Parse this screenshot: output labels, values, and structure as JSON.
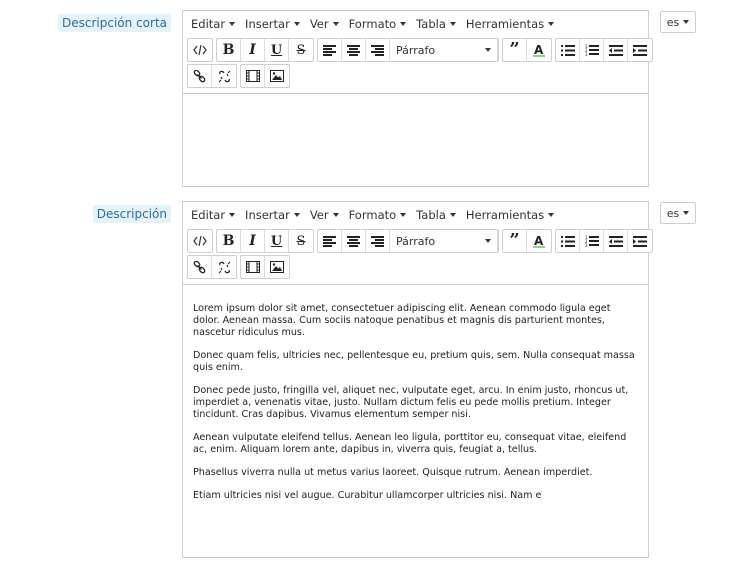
{
  "fields": [
    {
      "label": "Descripción corta",
      "menus": [
        "Editar",
        "Insertar",
        "Ver",
        "Formato",
        "Tabla",
        "Herramientas"
      ],
      "format_select": "Párrafo",
      "lang": "es",
      "paragraphs": []
    },
    {
      "label": "Descripción",
      "menus": [
        "Editar",
        "Insertar",
        "Ver",
        "Formato",
        "Tabla",
        "Herramientas"
      ],
      "format_select": "Párrafo",
      "lang": "es",
      "paragraphs": [
        "Lorem ipsum dolor sit amet, consectetuer adipiscing elit. Aenean commodo ligula eget dolor. Aenean massa. Cum sociis natoque penatibus et magnis dis parturient montes, nascetur ridiculus mus.",
        "Donec quam felis, ultricies nec, pellentesque eu, pretium quis, sem. Nulla consequat massa quis enim.",
        "Donec pede justo, fringilla vel, aliquet nec, vulputate eget, arcu. In enim justo, rhoncus ut, imperdiet a, venenatis vitae, justo. Nullam dictum felis eu pede mollis pretium. Integer tincidunt. Cras dapibus. Vivamus elementum semper nisi.",
        "Aenean vulputate eleifend tellus. Aenean leo ligula, porttitor eu, consequat vitae, eleifend ac, enim. Aliquam lorem ante, dapibus in, viverra quis, feugiat a, tellus.",
        "Phasellus viverra nulla ut metus varius laoreet. Quisque rutrum. Aenean imperdiet.",
        "Etiam ultricies nisi vel augue. Curabitur ullamcorper ultricies nisi. Nam e"
      ]
    }
  ],
  "toolbar_buttons": {
    "bold": "B",
    "italic": "I",
    "underline": "U",
    "strike": "S"
  },
  "icons": [
    "code-icon",
    "bold-icon",
    "italic-icon",
    "underline-icon",
    "strikethrough-icon",
    "align-left-icon",
    "align-center-icon",
    "align-right-icon",
    "blockquote-icon",
    "text-color-icon",
    "bullet-list-icon",
    "numbered-list-icon",
    "outdent-icon",
    "indent-icon",
    "link-icon",
    "unlink-icon",
    "media-icon",
    "image-icon"
  ]
}
